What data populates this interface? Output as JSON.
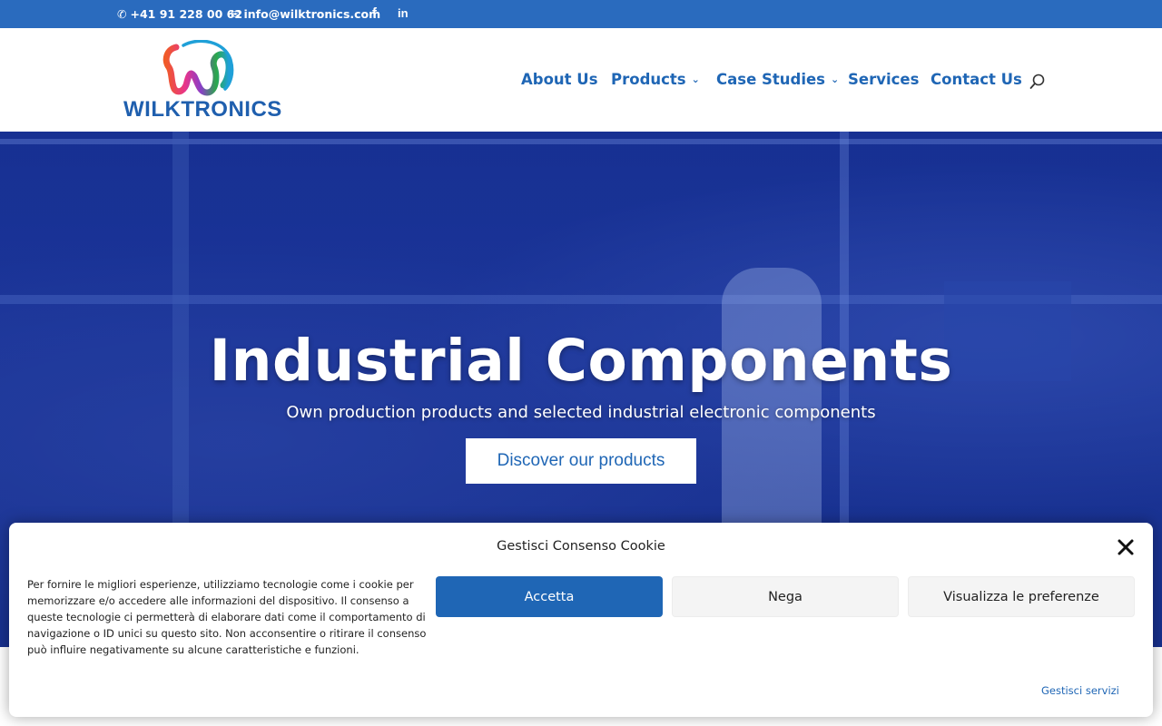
{
  "topbar": {
    "phone": "+41 91 228 00 62",
    "email": "info@wilktronics.com",
    "facebook_icon": "facebook-icon",
    "linkedin_icon": "linkedin-icon"
  },
  "brand": {
    "name": "WILKTRONICS",
    "colors": {
      "primary": "#1f66b5",
      "topbar": "#2a6bbe"
    }
  },
  "nav": {
    "items": [
      {
        "label": "About Us",
        "has_dropdown": false
      },
      {
        "label": "Products",
        "has_dropdown": true
      },
      {
        "label": "Case Studies",
        "has_dropdown": true
      },
      {
        "label": "Services",
        "has_dropdown": false
      },
      {
        "label": "Contact Us",
        "has_dropdown": false
      }
    ],
    "search_icon": "search-icon"
  },
  "hero": {
    "title": "Industrial Components",
    "subtitle": "Own production products and selected industrial electronic components",
    "cta": "Discover our products"
  },
  "cookie": {
    "title": "Gestisci Consenso Cookie",
    "text": "Per fornire le migliori esperienze, utilizziamo tecnologie come i cookie per memorizzare e/o accedere alle informazioni del dispositivo. Il consenso a queste tecnologie ci permetterà di elaborare dati come il comportamento di navigazione o ID unici su questo sito. Non acconsentire o ritirare il consenso può influire negativamente su alcune caratteristiche e funzioni.",
    "accept": "Accetta",
    "deny": "Nega",
    "preferences": "Visualizza le preferenze",
    "manage_services": "Gestisci servizi"
  }
}
